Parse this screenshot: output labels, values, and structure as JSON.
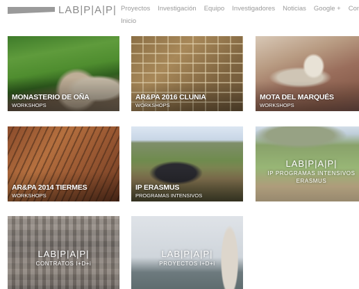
{
  "header": {
    "logo_text": "LAB|P|A|P|",
    "nav": [
      "Proyectos",
      "Investigación",
      "Equipo",
      "Investigadores",
      "Noticias",
      "Google +",
      "Contacto"
    ],
    "nav_row2": [
      "Inicio"
    ]
  },
  "tiles": [
    {
      "title": "MONASTERIO DE OÑA",
      "subtitle": "WORKSHOPS"
    },
    {
      "title": "AR&PA 2016 CLUNIA",
      "subtitle": "WORKSHOPS"
    },
    {
      "title": "MOTA DEL MARQUÉS",
      "subtitle": "WORKSHOPS"
    },
    {
      "title": "AR&PA 2014 TIERMES",
      "subtitle": "WORKSHOPS"
    },
    {
      "title": "IP ERASMUS",
      "subtitle": "PROGRAMAS INTENSIVOS"
    },
    {
      "brand": "LAB|P|A|P|",
      "line1": "IP PROGRAMAS INTENSIVOS",
      "line2": "ERASMUS"
    },
    {
      "brand": "LAB|P|A|P|",
      "line1": "CONTRATOS I+D+i"
    },
    {
      "brand": "LAB|P|A|P|",
      "line1": "PROYECTOS I+D+i"
    }
  ]
}
